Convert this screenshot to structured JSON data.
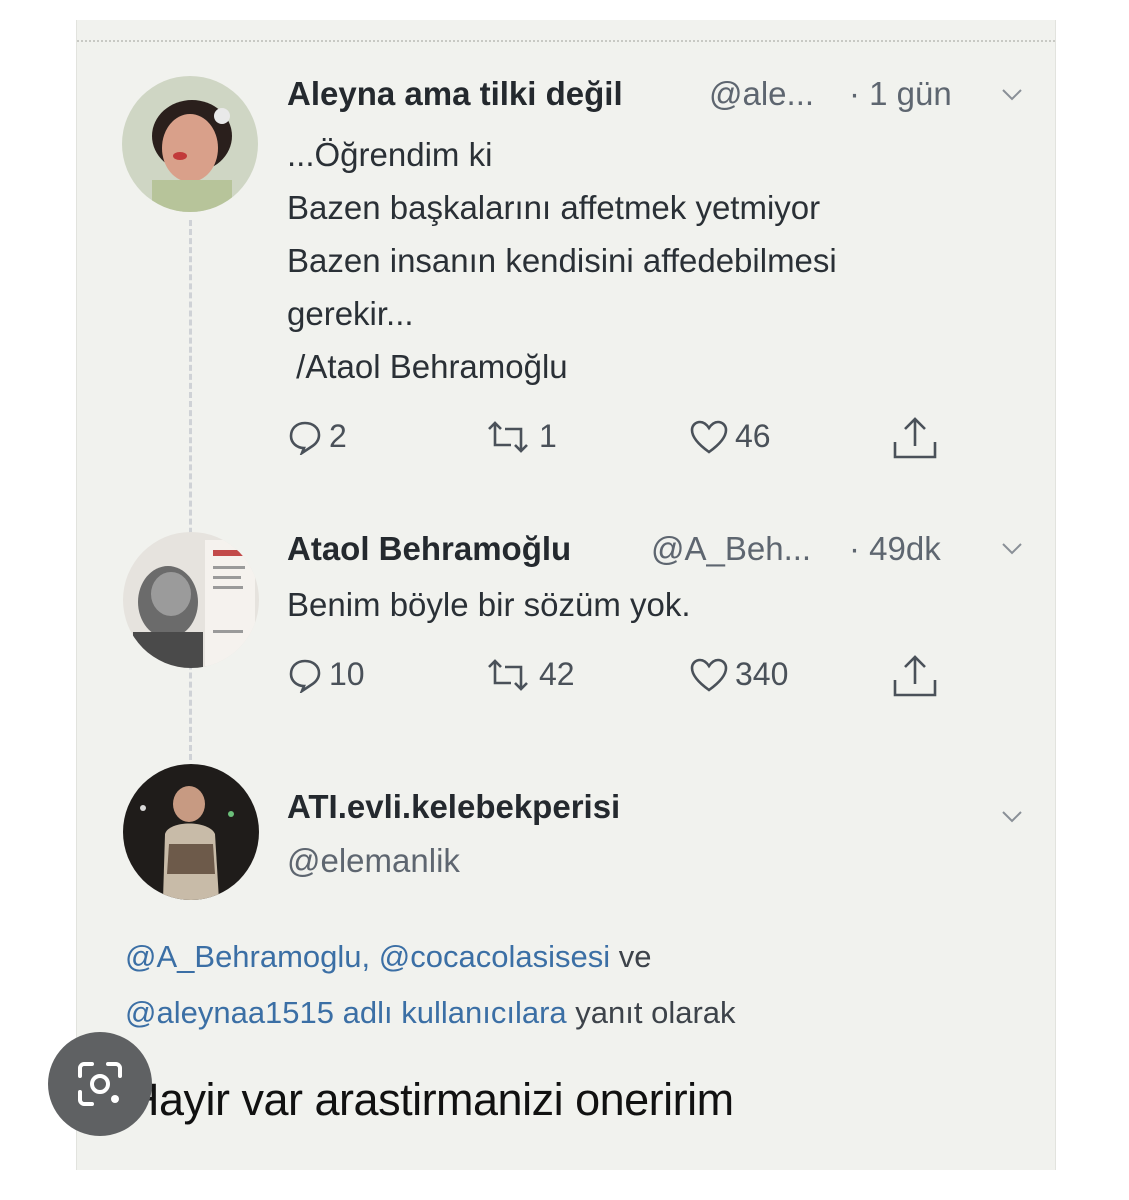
{
  "tweets": [
    {
      "display_name": "Aleyna ama tilki değil",
      "handle": "@ale...",
      "time": "· 1 gün",
      "lines": [
        "...Öğrendim ki",
        "Bazen başkalarını affetmek yetmiyor",
        "Bazen insanın kendisini affedebilmesi",
        "gerekir...",
        " /Ataol Behramoğlu"
      ],
      "replies": "2",
      "retweets": "1",
      "likes": "46"
    },
    {
      "display_name": "Ataol Behramoğlu",
      "handle": "@A_Beh...",
      "time": "· 49dk",
      "lines": [
        "Benim böyle bir sözüm yok."
      ],
      "replies": "10",
      "retweets": "42",
      "likes": "340"
    },
    {
      "display_name": "ATI.evli.kelebekperisi",
      "handle": "@elemanlik",
      "reply_to": {
        "line1_mentions": "@A_Behramoglu, @cocacolasisesi",
        "line1_plain": " ve",
        "line2_mentions": "@aleynaa1515 adlı kullanıcılara",
        "line2_plain": " yanıt olarak"
      },
      "text": "Hayir var arastirmanizi oneririm"
    }
  ],
  "icons": {
    "reply": "reply-bubble-icon",
    "retweet": "retweet-icon",
    "like": "heart-icon",
    "share": "share-icon",
    "menu": "chevron-down-icon",
    "lens": "google-lens-icon"
  },
  "colors": {
    "link": "#3b6fa5",
    "background": "#f1f2ee"
  }
}
